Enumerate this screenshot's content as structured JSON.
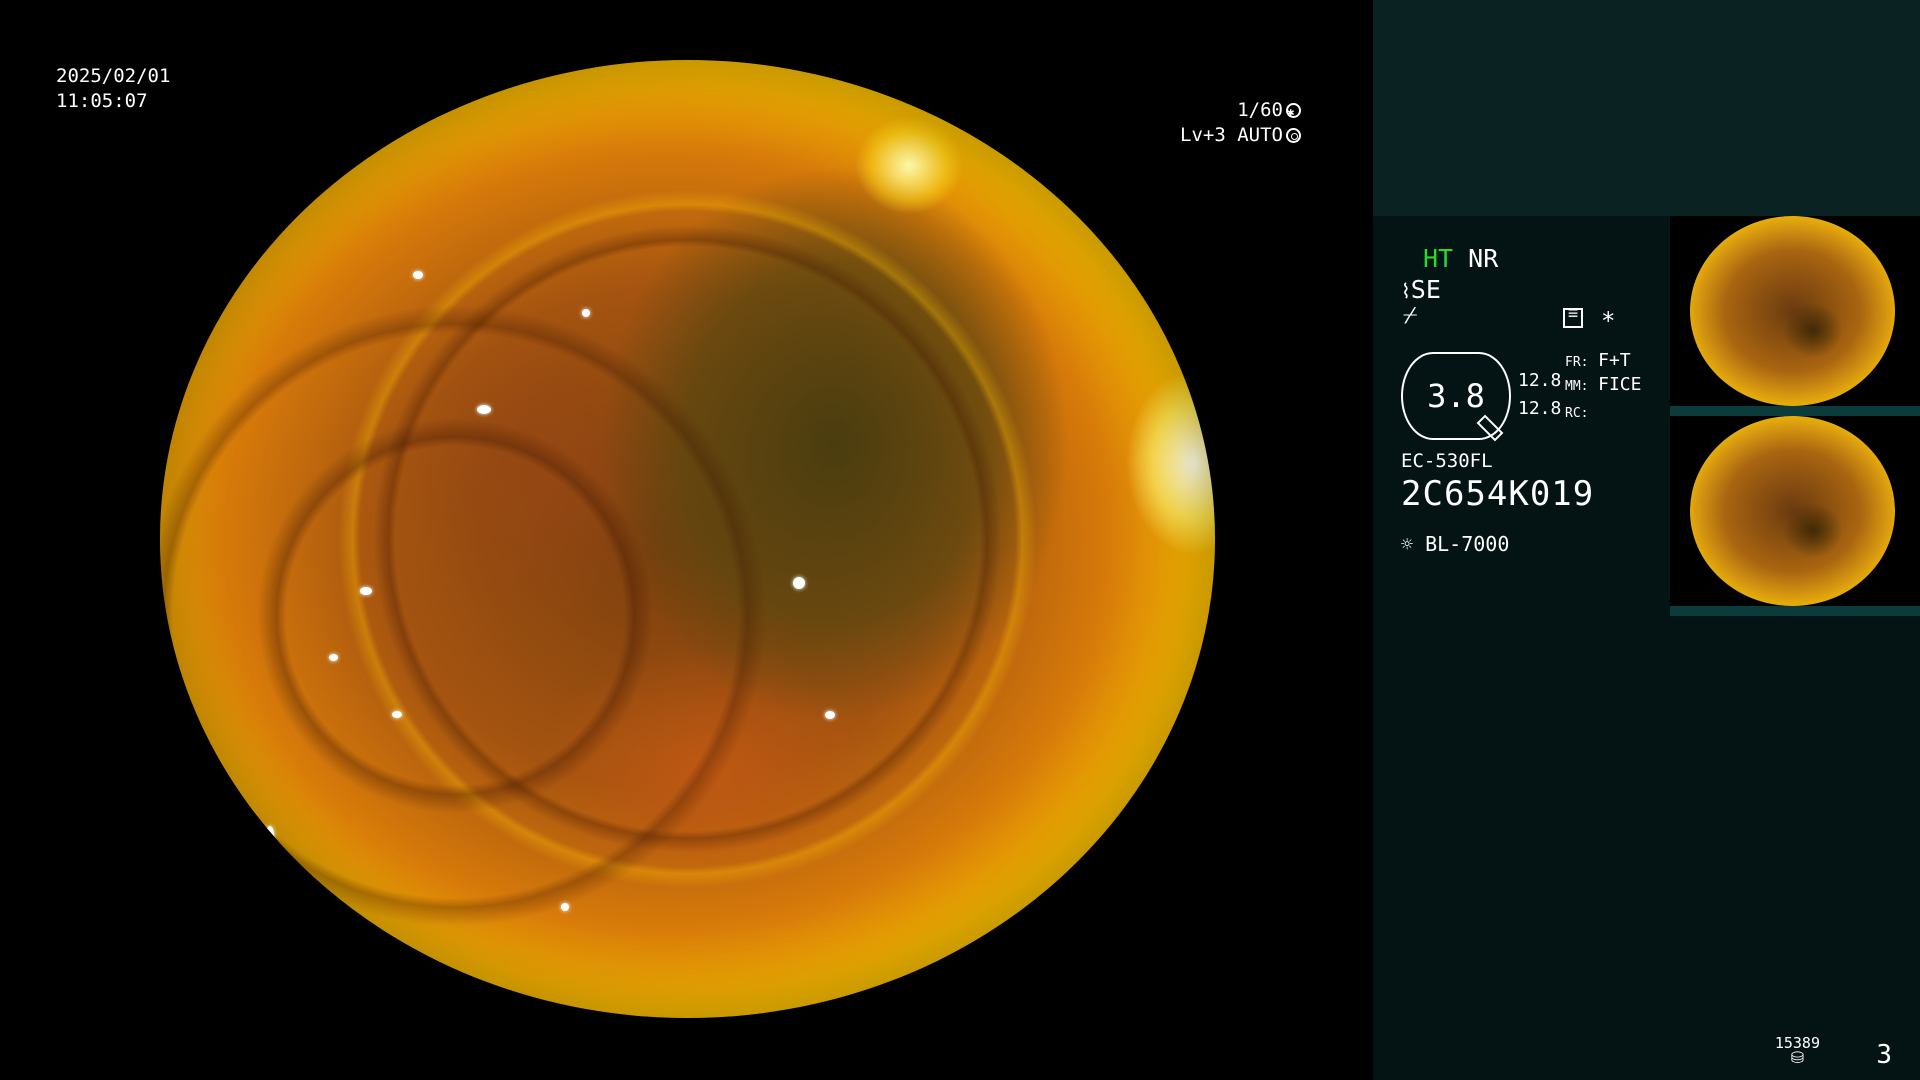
{
  "overlay": {
    "date": "2025/02/01",
    "time": "11:05:07",
    "shutter": "1/60",
    "brightness": "Lv+3 AUTO"
  },
  "status": {
    "ht": "HT",
    "nr": "NR",
    "se": "SE",
    "zoom_value": "3.8",
    "val1": "12.8",
    "val2": "12.8",
    "fr_label": "FR:",
    "fr_value": "F+T",
    "mm_label": "MM:",
    "mm_value": "FICE",
    "rc_label": "RC:",
    "asterisk": "*",
    "scope_model": "EC-530FL",
    "scope_serial": "2C654K019",
    "light_source": "BL-7000"
  },
  "footer": {
    "image_count": "15389",
    "page": "3"
  },
  "icons": [
    "shutter-icon",
    "auto-iris-icon",
    "scope-icon",
    "flash-icon",
    "menu-icon",
    "light-icon",
    "storage-icon"
  ]
}
